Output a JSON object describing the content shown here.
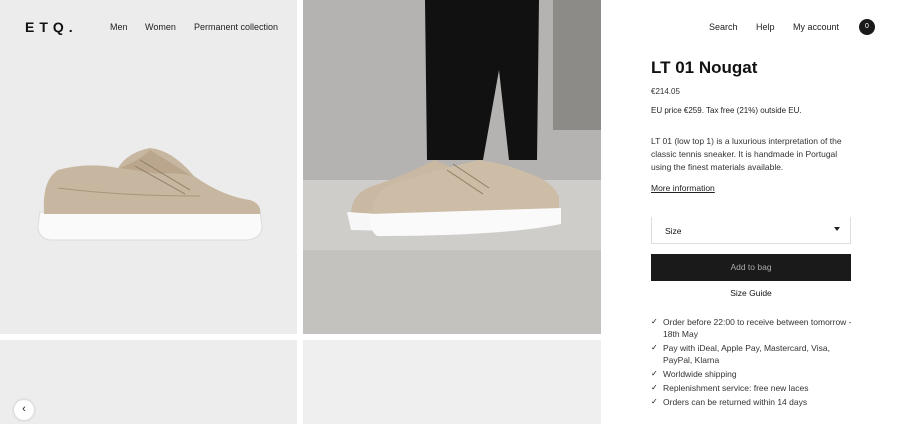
{
  "header": {
    "logo": "ETQ.",
    "nav": [
      "Men",
      "Women",
      "Permanent collection"
    ],
    "utility": [
      "Search",
      "Help",
      "My account"
    ],
    "cart_count": "0"
  },
  "product": {
    "title": "LT 01 Nougat",
    "price": "€214.05",
    "eu_note": "EU price €259. Tax free (21%) outside EU.",
    "description": "LT 01 (low top 1) is a luxurious interpretation of the classic tennis sneaker. It is handmade in Portugal using the finest materials available.",
    "more_link": "More information",
    "size_label": "Size",
    "add_button": "Add to bag",
    "size_guide": "Size Guide",
    "features": [
      "Order before 22:00 to receive between tomorrow - 18th May",
      "Pay with iDeal, Apple Pay, Mastercard, Visa, PayPal, Klarna",
      "Worldwide shipping",
      "Replenishment service: free new laces",
      "Orders can be returned within 14 days"
    ]
  },
  "gallery": {
    "prev_icon": "‹",
    "check_icon": "✓"
  }
}
